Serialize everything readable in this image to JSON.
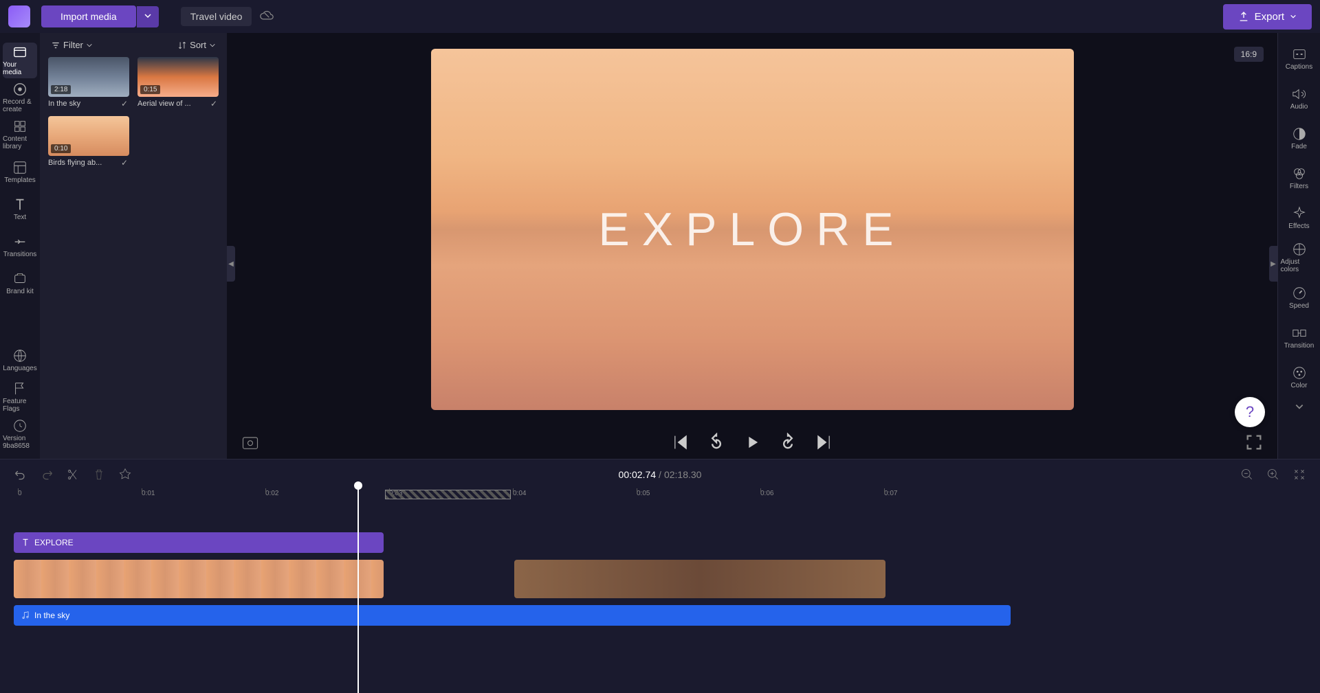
{
  "app": {
    "project_name": "Travel video"
  },
  "toolbar": {
    "import_label": "Import media",
    "export_label": "Export"
  },
  "media_panel": {
    "filter_label": "Filter",
    "sort_label": "Sort",
    "items": [
      {
        "name": "In the sky",
        "duration": "2:18",
        "thumb": "sky"
      },
      {
        "name": "Aerial view of ...",
        "duration": "0:15",
        "thumb": "mountain"
      },
      {
        "name": "Birds flying ab...",
        "duration": "0:10",
        "thumb": "birds"
      }
    ]
  },
  "left_sidebar": {
    "items": [
      {
        "label": "Your media"
      },
      {
        "label": "Record & create"
      },
      {
        "label": "Content library"
      },
      {
        "label": "Templates"
      },
      {
        "label": "Text"
      },
      {
        "label": "Transitions"
      },
      {
        "label": "Brand kit"
      }
    ],
    "bottom": {
      "languages": "Languages",
      "feature_flags": "Feature Flags",
      "version": "Version 9ba8658"
    }
  },
  "preview": {
    "overlay_text": "EXPLORE",
    "aspect_ratio": "16:9"
  },
  "timeline": {
    "current_time": "00:02.74",
    "total_time": "02:18.30",
    "ruler": [
      "0",
      "0:01",
      "0:02",
      "0:03",
      "0:04",
      "0:05",
      "0:06",
      "0:07"
    ],
    "text_clip_label": "EXPLORE",
    "audio_clip_label": "In the sky"
  },
  "right_sidebar": {
    "items": [
      {
        "label": "Captions"
      },
      {
        "label": "Audio"
      },
      {
        "label": "Fade"
      },
      {
        "label": "Filters"
      },
      {
        "label": "Effects"
      },
      {
        "label": "Adjust colors"
      },
      {
        "label": "Speed"
      },
      {
        "label": "Transition"
      },
      {
        "label": "Color"
      }
    ]
  },
  "help": {
    "symbol": "?"
  }
}
